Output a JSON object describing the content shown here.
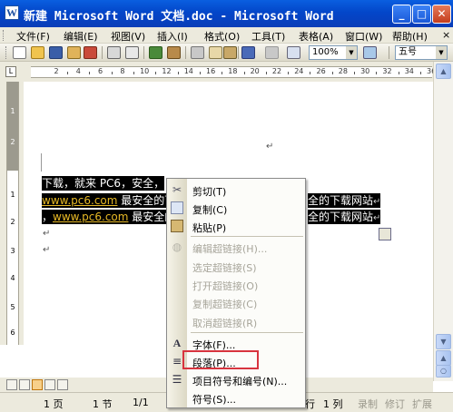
{
  "window": {
    "title": "新建 Microsoft Word 文档.doc - Microsoft Word",
    "icon_letter": "W",
    "minimize_glyph": "_",
    "maximize_glyph": "□",
    "close_glyph": "✕"
  },
  "menu": {
    "items": [
      "文件(F)",
      "编辑(E)",
      "视图(V)",
      "插入(I)",
      "格式(O)",
      "工具(T)",
      "表格(A)",
      "窗口(W)",
      "帮助(H)"
    ],
    "close_glyph": "×"
  },
  "toolbar": {
    "zoom": "100%",
    "font_size": "五号",
    "dropdown_glyph": "▼",
    "icons": [
      "new-icon",
      "open-icon",
      "save-icon",
      "permission-icon",
      "email-icon",
      "print-icon",
      "print-preview-icon",
      "spelling-icon",
      "research-icon",
      "cut-icon",
      "copy-icon",
      "paste-icon",
      "format-painter-icon",
      "undo-icon",
      "redo-icon",
      "hyperlink-icon",
      "table-icon"
    ]
  },
  "ruler": {
    "corner_glyph": "L",
    "numbers": [
      "2",
      "4",
      "6",
      "8",
      "10",
      "12",
      "14",
      "16",
      "18",
      "20",
      "22",
      "24",
      "26",
      "28",
      "30",
      "32",
      "34",
      "36",
      "38"
    ],
    "vertical_numbers": [
      "1",
      "2",
      "1",
      "2",
      "3",
      "4",
      "5",
      "6",
      "7",
      "8"
    ]
  },
  "document": {
    "para_mark": "↵",
    "line1": "下载，就来 PC6，安全，",
    "link_text": "www.pc6.com",
    "line2_mid": " 最安全的下",
    "line2_tail": "全的下载网站",
    "line3_prefix": "，",
    "line3_mid": " 最安全的",
    "line3_tail": "全的下载网站"
  },
  "context_menu": {
    "items": [
      {
        "label": "剪切(T)",
        "enabled": true,
        "icon": "cut-icon"
      },
      {
        "label": "复制(C)",
        "enabled": true,
        "icon": "copy-icon"
      },
      {
        "label": "粘贴(P)",
        "enabled": true,
        "icon": "paste-icon"
      },
      {
        "label": "编辑超链接(H)...",
        "enabled": false,
        "icon": "edit-hyperlink-icon"
      },
      {
        "label": "选定超链接(S)",
        "enabled": false,
        "icon": ""
      },
      {
        "label": "打开超链接(O)",
        "enabled": false,
        "icon": ""
      },
      {
        "label": "复制超链接(C)",
        "enabled": false,
        "icon": ""
      },
      {
        "label": "取消超链接(R)",
        "enabled": false,
        "icon": ""
      },
      {
        "label": "字体(F)...",
        "enabled": true,
        "icon": "font-icon"
      },
      {
        "label": "段落(P)...",
        "enabled": true,
        "icon": "paragraph-icon"
      },
      {
        "label": "项目符号和编号(N)...",
        "enabled": true,
        "icon": "bullets-icon"
      },
      {
        "label": "符号(S)...",
        "enabled": true,
        "icon": ""
      }
    ]
  },
  "statusbar": {
    "page": "1 页",
    "section": "1 节",
    "page_of": "1/1",
    "line": "行",
    "column": "1 列",
    "rec": "录制",
    "trk": "修订",
    "ext": "扩展"
  },
  "scrollbar": {
    "up_glyph": "▲",
    "down_glyph": "▼",
    "prev_glyph": "▲",
    "browse_glyph": "○",
    "next_glyph": "▼"
  }
}
